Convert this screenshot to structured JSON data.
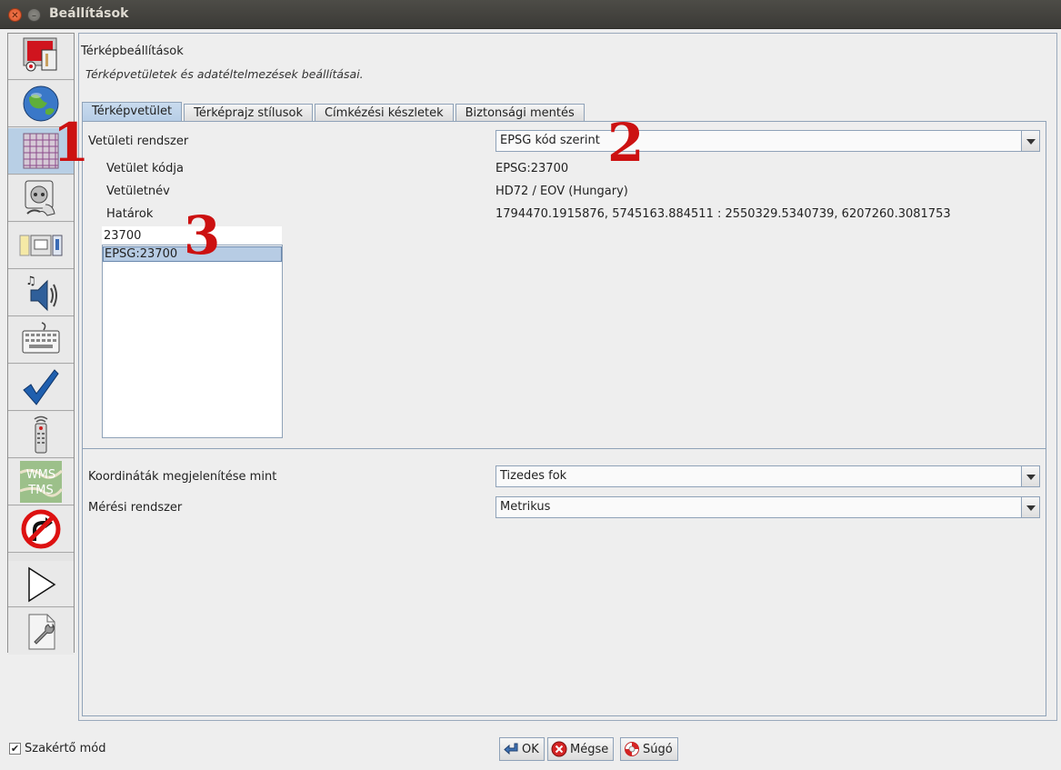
{
  "window": {
    "title": "Beállítások"
  },
  "panel": {
    "title": "Térképbeállítások",
    "subtitle": "Térképvetületek és adatéltelmezések beállításai."
  },
  "tabs": [
    {
      "label": "Térképvetület",
      "active": true
    },
    {
      "label": "Térképrajz stílusok",
      "active": false
    },
    {
      "label": "Címkézési készletek",
      "active": false
    },
    {
      "label": "Biztonsági mentés",
      "active": false
    }
  ],
  "projection": {
    "system_label": "Vetületi rendszer",
    "system_value": "EPSG kód szerint",
    "code_label": "Vetület kódja",
    "code_value": "EPSG:23700",
    "name_label": "Vetületnév",
    "name_value": "HD72 / EOV (Hungary)",
    "bounds_label": "Határok",
    "bounds_value": "1794470.1915876, 5745163.884511 : 2550329.5340739, 6207260.3081753",
    "search_value": "23700",
    "list_items": [
      "EPSG:23700"
    ]
  },
  "coordinates": {
    "label": "Koordináták megjelenítése mint",
    "value": "Tizedes fok"
  },
  "measurement": {
    "label": "Mérési rendszer",
    "value": "Metrikus"
  },
  "markers": [
    "1",
    "2",
    "3"
  ],
  "footer": {
    "expert_mode_label": "Szakértő mód",
    "expert_mode_checked": true,
    "ok_label": "OK",
    "cancel_label": "Mégse",
    "help_label": "Súgó"
  },
  "sidebar": {
    "items": [
      {
        "icon": "display-preferences-icon"
      },
      {
        "icon": "connection-globe-icon"
      },
      {
        "icon": "map-projection-grid-icon",
        "selected": true
      },
      {
        "icon": "plugin-socket-icon"
      },
      {
        "icon": "presets-folder-icon"
      },
      {
        "icon": "audio-speaker-icon"
      },
      {
        "icon": "keyboard-shortcuts-icon"
      },
      {
        "icon": "validator-checkmark-icon"
      },
      {
        "icon": "remote-control-icon"
      },
      {
        "icon": "wms-tms-imagery-icon",
        "text": "WMS TMS"
      },
      {
        "icon": "no-turn-restriction-icon"
      },
      {
        "icon": "draw-triangle-icon"
      },
      {
        "icon": "advanced-settings-icon"
      }
    ]
  },
  "colors": {
    "marker_red": "#cc1111",
    "selection_blue": "#b7cce4",
    "titlebar": "#3e3d39"
  }
}
